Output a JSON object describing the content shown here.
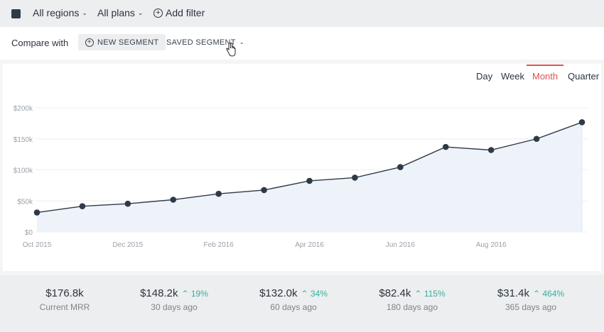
{
  "filters": {
    "regions_label": "All regions",
    "plans_label": "All plans",
    "add_filter_label": "Add filter"
  },
  "compare": {
    "label": "Compare with",
    "new_segment": "NEW SEGMENT",
    "saved_segment": "SAVED SEGMENT"
  },
  "periods": [
    {
      "label": "Day",
      "active": false
    },
    {
      "label": "Week",
      "active": false
    },
    {
      "label": "Month",
      "active": true
    },
    {
      "label": "Quarter",
      "active": false
    }
  ],
  "colors": {
    "accent": "#e05252",
    "line": "#2f3a48",
    "area": "#eef3fa",
    "positive": "#35b0a0"
  },
  "chart_data": {
    "type": "area",
    "title": "",
    "xlabel": "",
    "ylabel": "",
    "ylim": [
      0,
      200000
    ],
    "yticks": [
      "$0",
      "$50k",
      "$100k",
      "$150k",
      "$200k"
    ],
    "yticks_values": [
      0,
      50000,
      100000,
      150000,
      200000
    ],
    "xticks": [
      "Oct 2015",
      "Dec 2015",
      "Feb 2016",
      "Apr 2016",
      "Jun 2016",
      "Aug 2016"
    ],
    "x": [
      "2015-10",
      "2015-11",
      "2015-12",
      "2016-01",
      "2016-02",
      "2016-03",
      "2016-04",
      "2016-05",
      "2016-06",
      "2016-07",
      "2016-08",
      "2016-09",
      "2016-10"
    ],
    "series": [
      {
        "values": [
          31400,
          41500,
          45500,
          52000,
          61500,
          67500,
          82400,
          87500,
          104500,
          137000,
          132000,
          150000,
          176800
        ]
      }
    ],
    "grid": true
  },
  "stats": [
    {
      "value": "$176.8k",
      "change": "",
      "label": "Current MRR"
    },
    {
      "value": "$148.2k",
      "change": "19%",
      "label": "30 days ago"
    },
    {
      "value": "$132.0k",
      "change": "34%",
      "label": "60 days ago"
    },
    {
      "value": "$82.4k",
      "change": "115%",
      "label": "180 days ago"
    },
    {
      "value": "$31.4k",
      "change": "464%",
      "label": "365 days ago"
    }
  ]
}
